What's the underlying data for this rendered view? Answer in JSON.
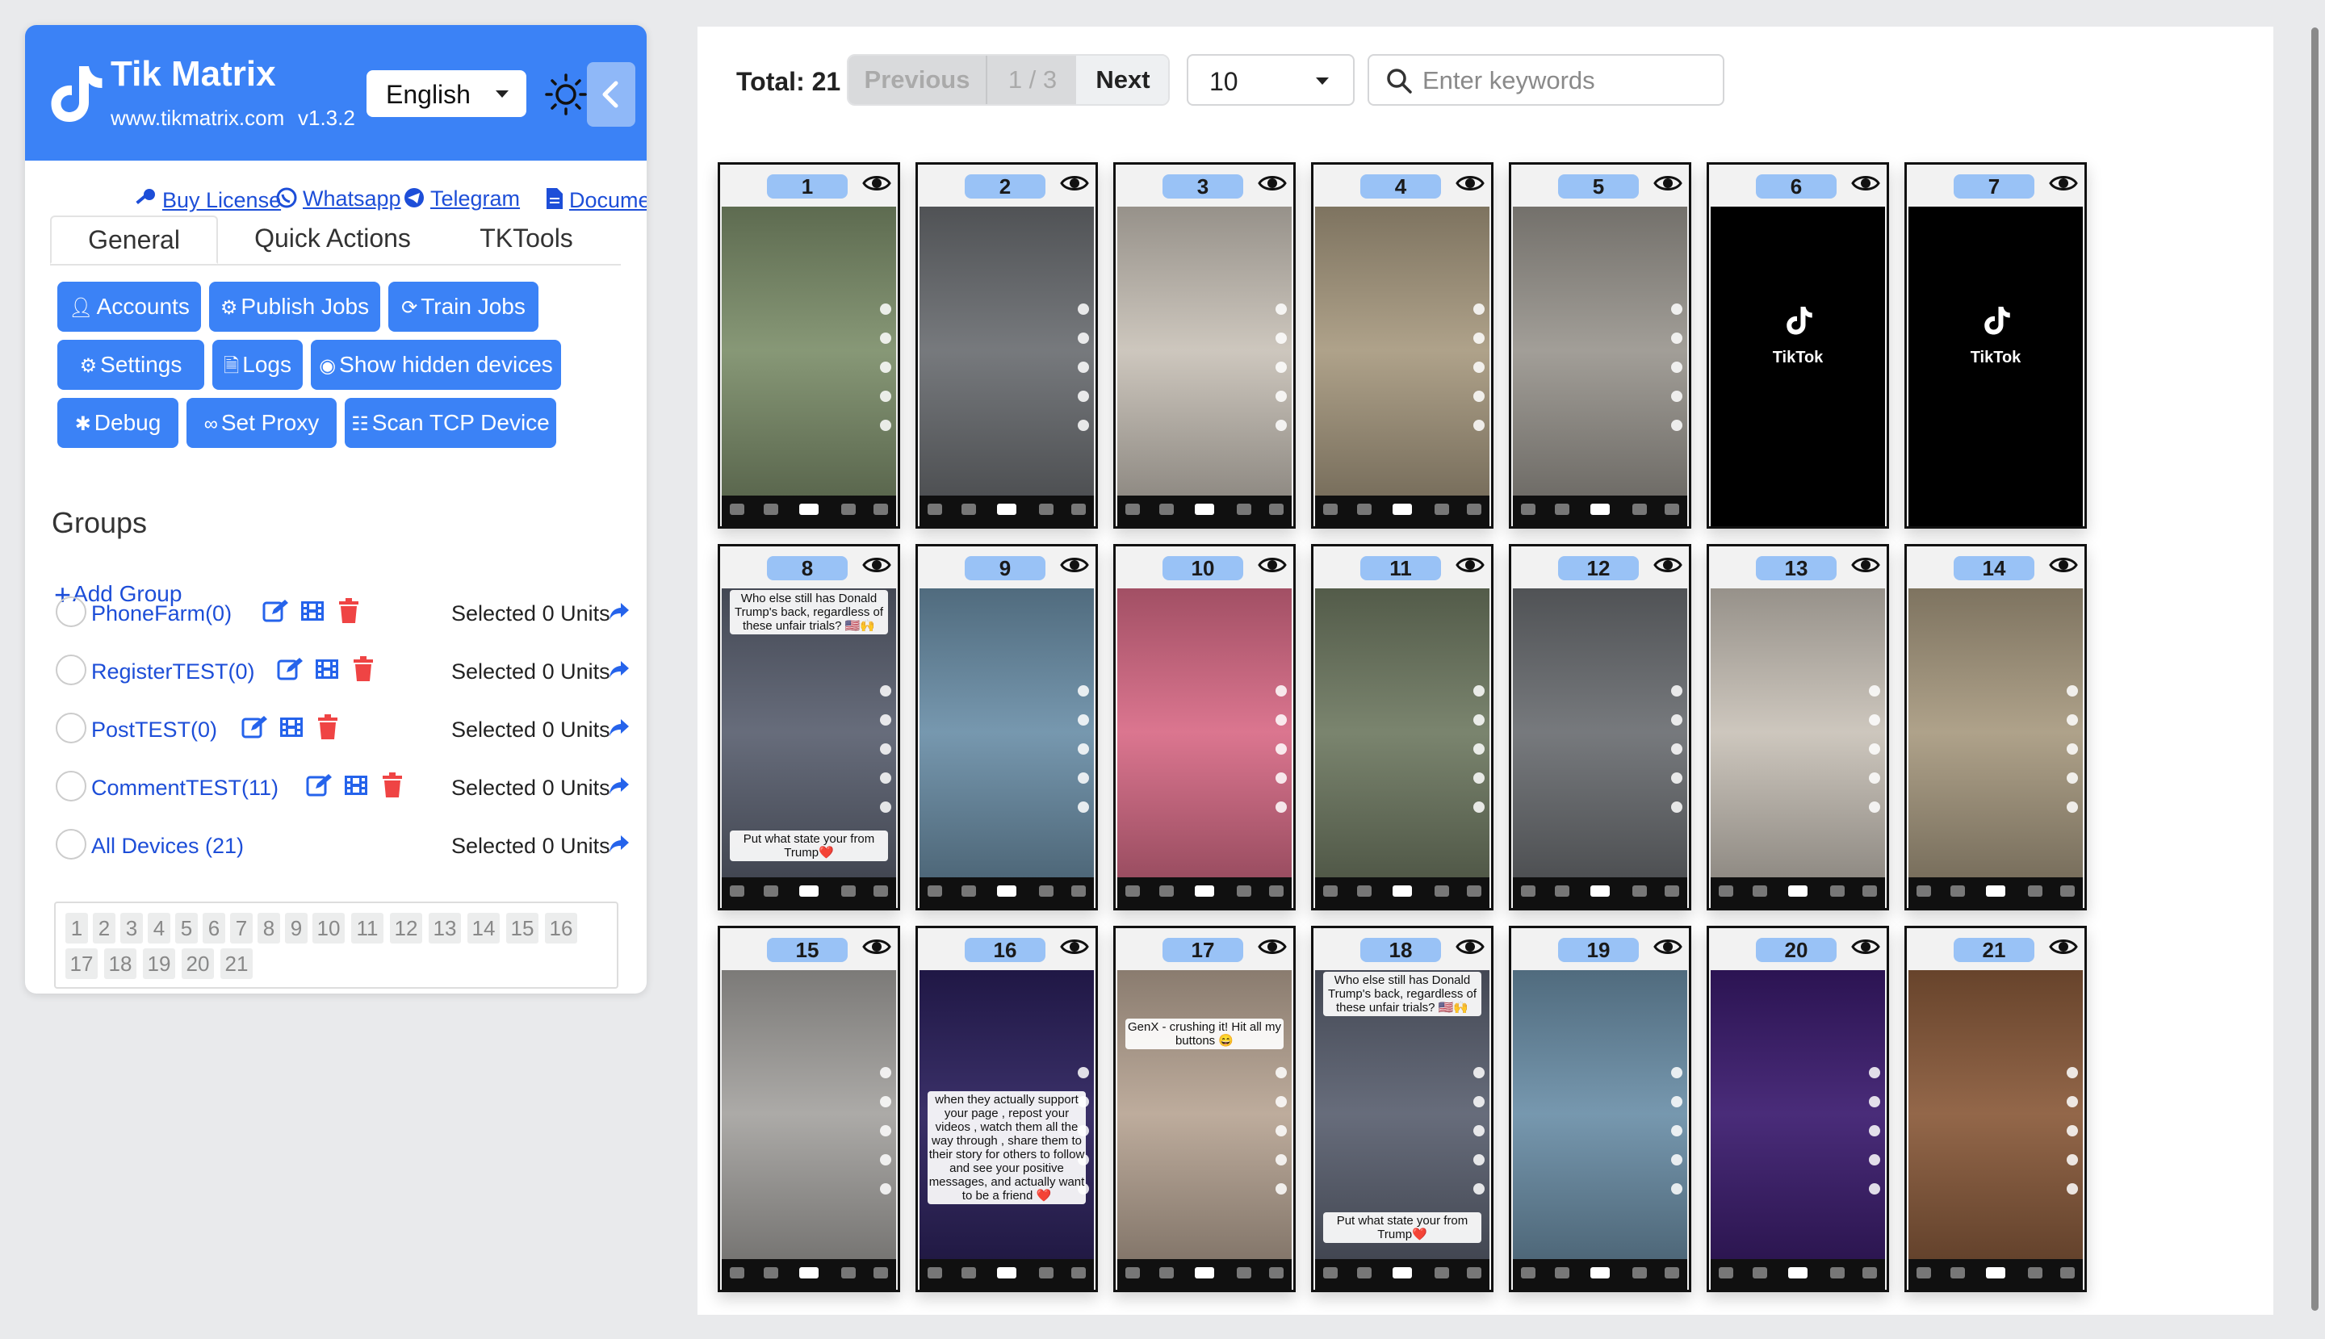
{
  "app": {
    "brand_name": "Tik Matrix",
    "brand_url": "www.tikmatrix.com",
    "version": "v1.3.2",
    "language": "English"
  },
  "links": [
    {
      "label": "Buy License",
      "icon": "key-icon"
    },
    {
      "label": "Whatsapp",
      "icon": "whatsapp-icon"
    },
    {
      "label": "Telegram",
      "icon": "telegram-icon"
    },
    {
      "label": "Document",
      "icon": "document-icon"
    }
  ],
  "tabs": [
    "General",
    "Quick Actions",
    "TKTools"
  ],
  "actions": [
    {
      "label": "Accounts",
      "icon": "user-icon"
    },
    {
      "label": "Publish Jobs",
      "icon": "robot-icon"
    },
    {
      "label": "Train Jobs",
      "icon": "refresh-icon"
    },
    {
      "label": "Settings",
      "icon": "gears-icon"
    },
    {
      "label": "Logs",
      "icon": "file-icon"
    },
    {
      "label": "Show hidden devices",
      "icon": "eye-icon"
    },
    {
      "label": "Debug",
      "icon": "bug-icon"
    },
    {
      "label": "Set Proxy",
      "icon": "link-icon"
    },
    {
      "label": "Scan TCP Device",
      "icon": "network-icon"
    }
  ],
  "groups": {
    "title": "Groups",
    "add_label": "Add Group",
    "items": [
      {
        "name": "PhoneFarm(0)",
        "selected": "Selected 0 Units"
      },
      {
        "name": "RegisterTEST(0)",
        "selected": "Selected 0 Units"
      },
      {
        "name": "PostTEST(0)",
        "selected": "Selected 0 Units"
      },
      {
        "name": "CommentTEST(11)",
        "selected": "Selected 0 Units"
      },
      {
        "name": "All Devices (21)",
        "selected": "Selected 0 Units"
      }
    ],
    "numbers": [
      "1",
      "2",
      "3",
      "4",
      "5",
      "6",
      "7",
      "8",
      "9",
      "10",
      "11",
      "12",
      "13",
      "14",
      "15",
      "16",
      "17",
      "18",
      "19",
      "20",
      "21"
    ]
  },
  "toolbar": {
    "total": "Total: 21",
    "prev": "Previous",
    "page": "1 / 3",
    "next": "Next",
    "per_page": "10",
    "search_placeholder": "Enter keywords"
  },
  "devices": [
    {
      "num": "1",
      "bg": "#7d8f6b",
      "caption": ""
    },
    {
      "num": "2",
      "bg": "#6b6e72",
      "caption": ""
    },
    {
      "num": "3",
      "bg": "#c9c2b8",
      "caption": ""
    },
    {
      "num": "4",
      "bg": "#a89a80",
      "caption": ""
    },
    {
      "num": "5",
      "bg": "#9a968f",
      "caption": ""
    },
    {
      "num": "6",
      "bg": "#000000",
      "splash": "TikTok"
    },
    {
      "num": "7",
      "bg": "#000000",
      "splash": "TikTok"
    },
    {
      "num": "8",
      "bg": "#5a6070",
      "caption": "Who else still has Donald Trump's back, regardless of these unfair trials? 🇺🇸🙌",
      "caption2": "Put what state your from Trump❤️"
    },
    {
      "num": "9",
      "bg": "#6b8fa8",
      "caption": ""
    },
    {
      "num": "10",
      "bg": "#d86a86",
      "caption": ""
    },
    {
      "num": "11",
      "bg": "#6f7a62",
      "caption": ""
    },
    {
      "num": "12",
      "bg": "#6b6e72",
      "caption": ""
    },
    {
      "num": "13",
      "bg": "#c9c2b8",
      "caption": ""
    },
    {
      "num": "14",
      "bg": "#a89a80",
      "caption": ""
    },
    {
      "num": "15",
      "bg": "#a5a3a0",
      "caption": ""
    },
    {
      "num": "16",
      "bg": "#2a1f5c",
      "caption": "when they actually support your page , repost your videos , watch them all the way through , share them to their story for others to follow and see your positive messages, and actually want to be a friend ❤️"
    },
    {
      "num": "17",
      "bg": "#b8a594",
      "caption": "GenX - crushing it! Hit all my buttons 😄"
    },
    {
      "num": "18",
      "bg": "#5a6070",
      "caption": "Who else still has Donald Trump's back, regardless of these unfair trials? 🇺🇸🙌",
      "caption2": "Put what state your from Trump❤️"
    },
    {
      "num": "19",
      "bg": "#6b8fa8",
      "caption": ""
    },
    {
      "num": "20",
      "bg": "#3a1a6e",
      "caption": ""
    },
    {
      "num": "21",
      "bg": "#8a5a3a",
      "caption": ""
    }
  ],
  "colors": {
    "accent": "#3b82f6",
    "danger": "#ef4444",
    "badge": "#99c2f6"
  }
}
